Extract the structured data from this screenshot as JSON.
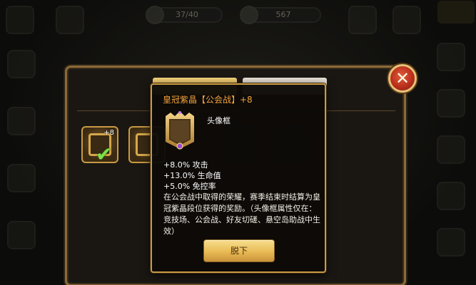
{
  "hud": {
    "stamina": "37/40",
    "gold": "567"
  },
  "popup": {
    "title": "皇冠紫晶【公会战】+8",
    "item_type": "头像框",
    "stats": [
      "+8.0% 攻击",
      "+13.0% 生命值",
      "+5.0% 免控率"
    ],
    "description": "在公会战中取得的荣耀，赛季结束时结算为皇冠紫晶段位获得的奖励。（头像框属性仅在：竞技场、公会战、好友切磋、悬空岛助战中生效）",
    "dismiss_label": "脱下"
  },
  "panel": {
    "equipped_slot_level": "+8"
  },
  "colors": {
    "title_orange": "#f2a33a",
    "panel_border": "#8c6a37",
    "button_gold": "#e8bb55",
    "close_red": "#b62c1a",
    "check_green": "#7de04a"
  },
  "icons": {
    "close": "close-icon",
    "check": "check-icon",
    "frame": "avatar-frame-icon"
  }
}
